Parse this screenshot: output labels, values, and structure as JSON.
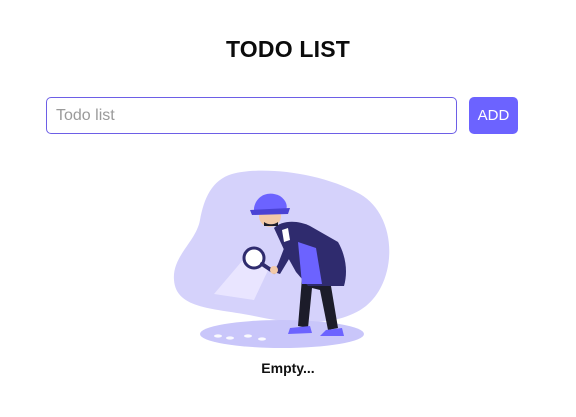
{
  "app": {
    "title": "TODO LIST"
  },
  "form": {
    "input_placeholder": "Todo list",
    "input_value": "",
    "add_label": "ADD"
  },
  "empty_state": {
    "message": "Empty...",
    "illustration": "detective-with-magnifying-glass"
  },
  "colors": {
    "accent": "#6c63ff",
    "blob": "#d5d2fb",
    "input_border": "#6d5fe6"
  }
}
